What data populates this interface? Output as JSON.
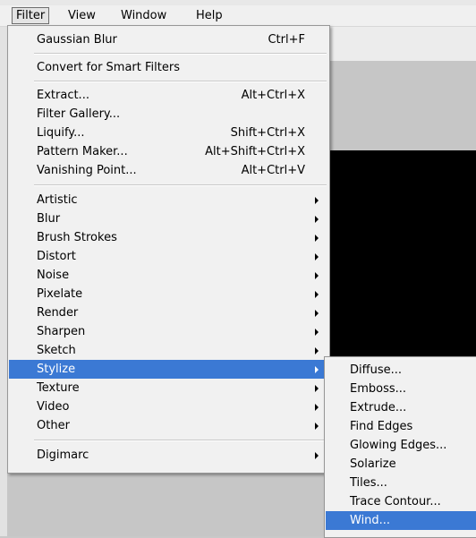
{
  "menubar": {
    "items": [
      "Filter",
      "View",
      "Window",
      "Help"
    ]
  },
  "filter_menu": {
    "group1": [
      {
        "label": "Gaussian Blur",
        "shortcut": "Ctrl+F"
      }
    ],
    "group2": [
      {
        "label": "Convert for Smart Filters"
      }
    ],
    "group3": [
      {
        "label": "Extract...",
        "shortcut": "Alt+Ctrl+X"
      },
      {
        "label": "Filter Gallery..."
      },
      {
        "label": "Liquify...",
        "shortcut": "Shift+Ctrl+X"
      },
      {
        "label": "Pattern Maker...",
        "shortcut": "Alt+Shift+Ctrl+X"
      },
      {
        "label": "Vanishing Point...",
        "shortcut": "Alt+Ctrl+V"
      }
    ],
    "group4": [
      {
        "label": "Artistic"
      },
      {
        "label": "Blur"
      },
      {
        "label": "Brush Strokes"
      },
      {
        "label": "Distort"
      },
      {
        "label": "Noise"
      },
      {
        "label": "Pixelate"
      },
      {
        "label": "Render"
      },
      {
        "label": "Sharpen"
      },
      {
        "label": "Sketch"
      },
      {
        "label": "Stylize"
      },
      {
        "label": "Texture"
      },
      {
        "label": "Video"
      },
      {
        "label": "Other"
      }
    ],
    "group5": [
      {
        "label": "Digimarc"
      }
    ],
    "highlighted": "Stylize"
  },
  "stylize_submenu": {
    "items": [
      "Diffuse...",
      "Emboss...",
      "Extrude...",
      "Find Edges",
      "Glowing Edges...",
      "Solarize",
      "Tiles...",
      "Trace Contour...",
      "Wind..."
    ],
    "highlighted": "Wind..."
  },
  "colors": {
    "highlight": "#3b79d4",
    "menu_bg": "#f1f1f1",
    "canvas": "#000000"
  }
}
